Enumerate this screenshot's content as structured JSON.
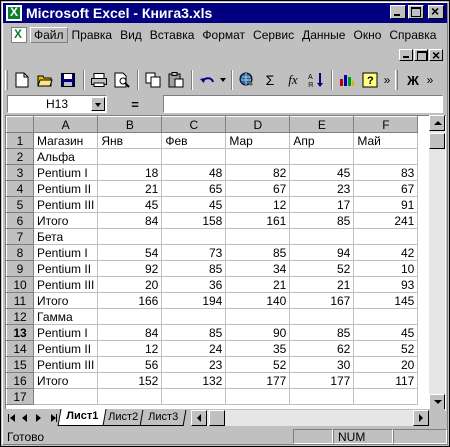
{
  "window": {
    "title": "Microsoft Excel - Книга3.xls"
  },
  "menu": [
    "Файл",
    "Правка",
    "Вид",
    "Вставка",
    "Формат",
    "Сервис",
    "Данные",
    "Окно",
    "Справка"
  ],
  "toolbar": {
    "sigma": "Σ",
    "fx": "fx",
    "bold": "Ж",
    "more": "»"
  },
  "formula": {
    "name_box": "H13",
    "eq": "=",
    "content": ""
  },
  "columns": [
    "A",
    "B",
    "C",
    "D",
    "E",
    "F"
  ],
  "rows": [
    {
      "n": "1",
      "cells": [
        "Магазин",
        "Янв",
        "Фев",
        "Мар",
        "Апр",
        "Май"
      ]
    },
    {
      "n": "2",
      "cells": [
        "Альфа",
        "",
        "",
        "",
        "",
        ""
      ]
    },
    {
      "n": "3",
      "cells": [
        "Pentium I",
        "18",
        "48",
        "82",
        "45",
        "83"
      ]
    },
    {
      "n": "4",
      "cells": [
        "Pentium II",
        "21",
        "65",
        "67",
        "23",
        "67"
      ]
    },
    {
      "n": "5",
      "cells": [
        "Pentium III",
        "45",
        "45",
        "12",
        "17",
        "91"
      ]
    },
    {
      "n": "6",
      "cells": [
        "Итого",
        "84",
        "158",
        "161",
        "85",
        "241"
      ]
    },
    {
      "n": "7",
      "cells": [
        "Бета",
        "",
        "",
        "",
        "",
        ""
      ]
    },
    {
      "n": "8",
      "cells": [
        "Pentium I",
        "54",
        "73",
        "85",
        "94",
        "42"
      ]
    },
    {
      "n": "9",
      "cells": [
        "Pentium II",
        "92",
        "85",
        "34",
        "52",
        "10"
      ]
    },
    {
      "n": "10",
      "cells": [
        "Pentium III",
        "20",
        "36",
        "21",
        "21",
        "93"
      ]
    },
    {
      "n": "11",
      "cells": [
        "Итого",
        "166",
        "194",
        "140",
        "167",
        "145"
      ]
    },
    {
      "n": "12",
      "cells": [
        "Гамма",
        "",
        "",
        "",
        "",
        ""
      ]
    },
    {
      "n": "13",
      "cells": [
        "Pentium I",
        "84",
        "85",
        "90",
        "85",
        "45"
      ]
    },
    {
      "n": "14",
      "cells": [
        "Pentium II",
        "12",
        "24",
        "35",
        "62",
        "52"
      ]
    },
    {
      "n": "15",
      "cells": [
        "Pentium III",
        "56",
        "23",
        "52",
        "30",
        "20"
      ]
    },
    {
      "n": "16",
      "cells": [
        "Итого",
        "152",
        "132",
        "177",
        "177",
        "117"
      ]
    },
    {
      "n": "17",
      "cells": [
        "",
        "",
        "",
        "",
        "",
        ""
      ]
    }
  ],
  "sheets": [
    "Лист1",
    "Лист2",
    "Лист3"
  ],
  "status": {
    "ready": "Готово",
    "num": "NUM"
  },
  "selected_row": "13",
  "colors": {
    "title_bar": "#000080",
    "face": "#c0c0c0",
    "excel_green": "#0a7f2e"
  }
}
